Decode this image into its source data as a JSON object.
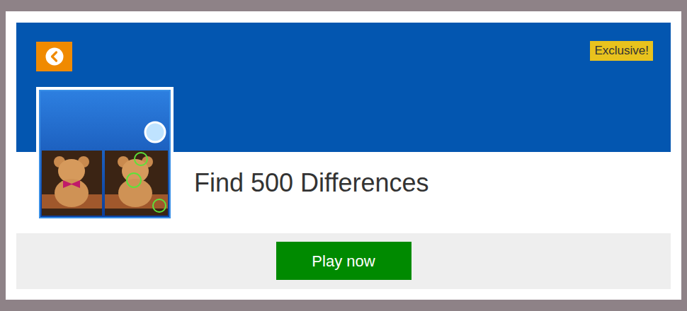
{
  "game": {
    "title": "Find 500 Differences",
    "badge": "Exclusive!"
  },
  "buttons": [
    "Play now"
  ]
}
